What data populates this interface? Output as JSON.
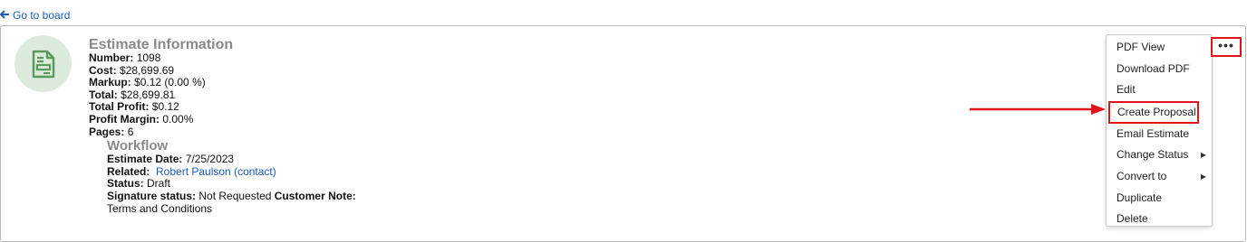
{
  "back_link": {
    "arrow": "🡐",
    "label": "Go to board"
  },
  "estimate": {
    "title": "Estimate Information",
    "fields": [
      {
        "label": "Number:",
        "value": "1098"
      },
      {
        "label": "Cost:",
        "value": "$28,699.69"
      },
      {
        "label": "Markup:",
        "value": "$0.12 (0.00 %)"
      },
      {
        "label": "Total:",
        "value": "$28,699.81"
      },
      {
        "label": "Total Profit:",
        "value": "$0.12"
      },
      {
        "label": "Profit Margin:",
        "value": "0.00%"
      },
      {
        "label": "Pages:",
        "value": "6"
      }
    ]
  },
  "workflow": {
    "title": "Workflow",
    "estimate_date_label": "Estimate Date:",
    "estimate_date_value": "7/25/2023",
    "related_label": "Related:",
    "related_value": "Robert Paulson (contact)",
    "status_label": "Status:",
    "status_value": "Draft",
    "signature_label": "Signature status:",
    "signature_value": "Not Requested",
    "customer_note_label": "Customer Note:",
    "terms": "Terms and Conditions"
  },
  "more_button": {
    "label": "•••",
    "highlight_color": "#e0151b"
  },
  "menu": {
    "items": [
      {
        "label": "PDF View"
      },
      {
        "label": "Download PDF"
      },
      {
        "label": "Edit"
      },
      {
        "label": "Create Proposal"
      },
      {
        "label": "Email Estimate"
      },
      {
        "label": "Change Status",
        "submenu_arrow": "▶"
      },
      {
        "label": "Convert to",
        "submenu_arrow": "▶"
      },
      {
        "label": "Duplicate"
      },
      {
        "label": "Delete"
      }
    ]
  },
  "colors": {
    "link": "#1a5bc4",
    "highlight": "#e0151b",
    "avatar_bg": "#dcebdc",
    "avatar_icon": "#5a9a5e",
    "heading": "#8a8a8a"
  }
}
